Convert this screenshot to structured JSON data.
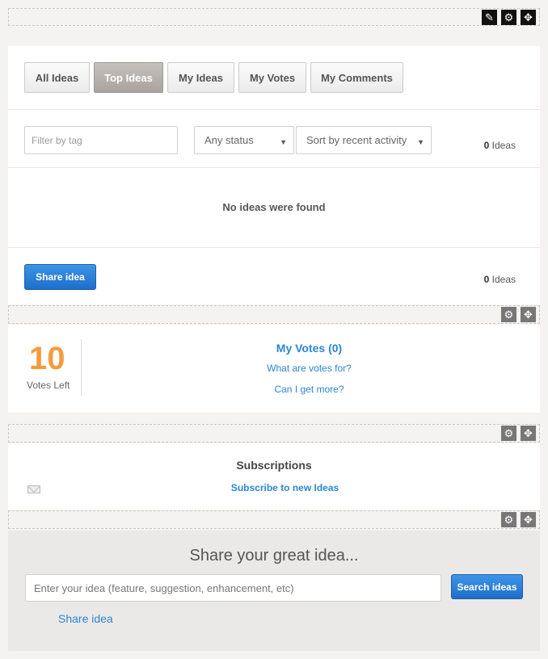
{
  "toolbar_top": {
    "icons": [
      "pencil-icon",
      "gear-icon",
      "move-icon"
    ]
  },
  "tabs": [
    {
      "label": "All Ideas",
      "active": false
    },
    {
      "label": "Top Ideas",
      "active": true
    },
    {
      "label": "My Ideas",
      "active": false
    },
    {
      "label": "My Votes",
      "active": false
    },
    {
      "label": "My Comments",
      "active": false
    }
  ],
  "filters": {
    "tag_placeholder": "Filter by tag",
    "status_value": "Any status",
    "sort_value": "Sort by recent activity"
  },
  "ideas_count_top": {
    "number": "0",
    "label": "Ideas"
  },
  "empty_message": "No ideas were found",
  "share_idea_button": "Share idea",
  "ideas_count_bottom": {
    "number": "0",
    "label": "Ideas"
  },
  "votes": {
    "number": "10",
    "label": "Votes Left",
    "title": "My Votes (0)",
    "link1": "What are votes for?",
    "link2": "Can I get more?"
  },
  "subscriptions": {
    "title": "Subscriptions",
    "link": "Subscribe to new Ideas"
  },
  "share": {
    "title": "Share your great idea...",
    "placeholder": "Enter your idea (feature, suggestion, enhancement, etc)",
    "search_button": "Search ideas",
    "share_link": "Share idea"
  },
  "colors": {
    "accent": "#2a86d6",
    "votes": "#f49b3c",
    "button": "#1d6ec9"
  }
}
